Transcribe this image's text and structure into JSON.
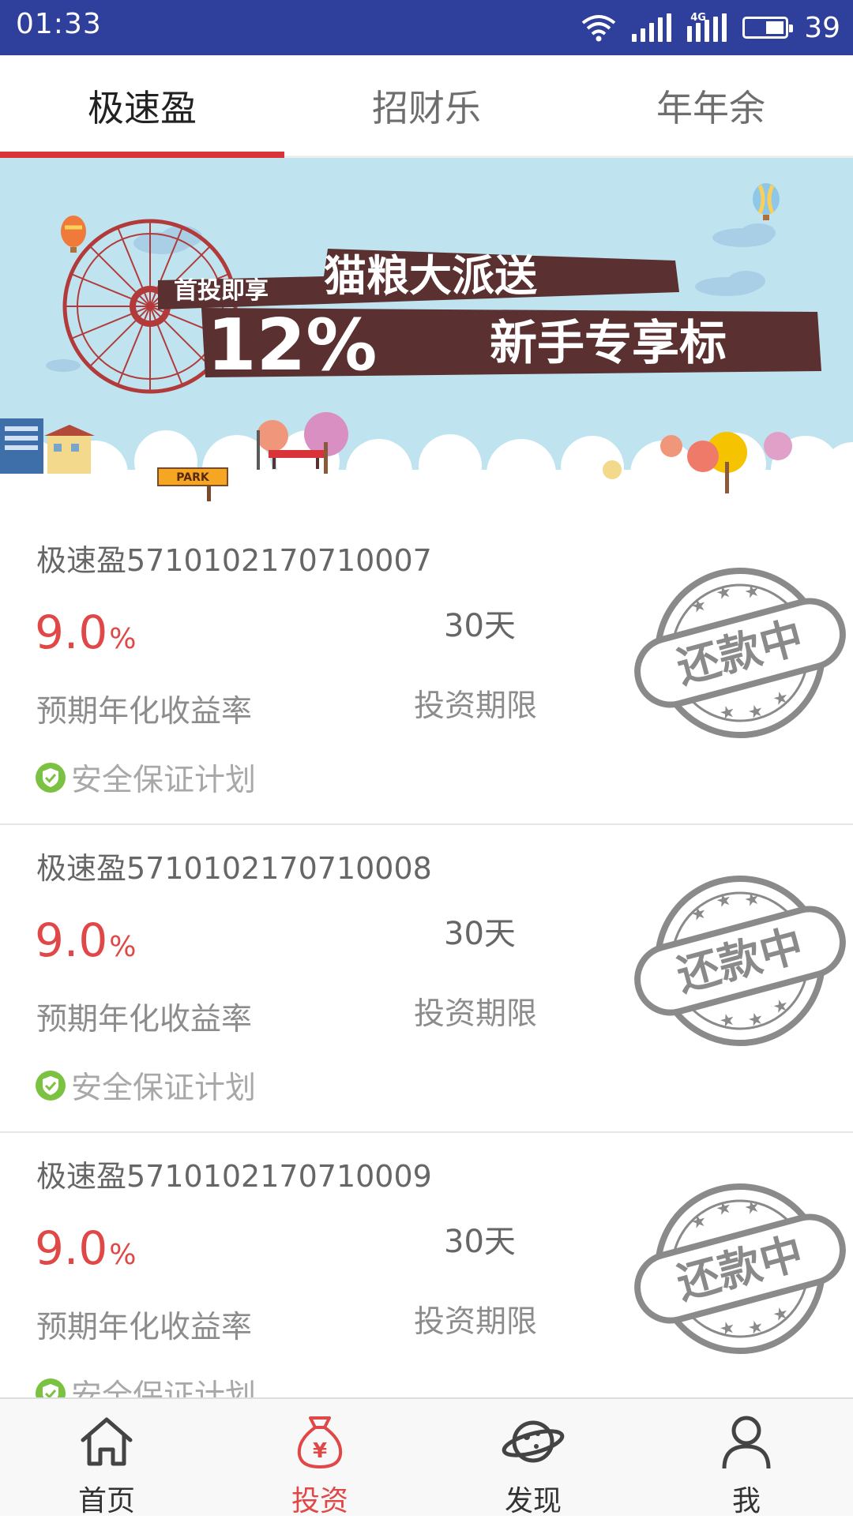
{
  "status_bar": {
    "time": "01:33",
    "network_tag": "4G",
    "battery": "39"
  },
  "tabs": [
    {
      "label": "极速盈",
      "active": true
    },
    {
      "label": "招财乐",
      "active": false
    },
    {
      "label": "年年余",
      "active": false
    }
  ],
  "banner": {
    "line1_small": "首投即享",
    "line1_big": "猫粮大派送",
    "line2_percent": "12%",
    "line2_text": "新手专享标",
    "park_sign": "PARK"
  },
  "products": [
    {
      "name": "极速盈5710102170710007",
      "rate": "9.0",
      "rate_unit": "%",
      "rate_label": "预期年化收益率",
      "term": "30天",
      "term_label": "投资期限",
      "safety": "安全保证计划",
      "status": "还款中"
    },
    {
      "name": "极速盈5710102170710008",
      "rate": "9.0",
      "rate_unit": "%",
      "rate_label": "预期年化收益率",
      "term": "30天",
      "term_label": "投资期限",
      "safety": "安全保证计划",
      "status": "还款中"
    },
    {
      "name": "极速盈5710102170710009",
      "rate": "9.0",
      "rate_unit": "%",
      "rate_label": "预期年化收益率",
      "term": "30天",
      "term_label": "投资期限",
      "safety": "安全保证计划",
      "status": "还款中"
    }
  ],
  "bottom_nav": [
    {
      "label": "首页",
      "icon": "home-icon",
      "active": false
    },
    {
      "label": "投资",
      "icon": "money-bag-icon",
      "active": true
    },
    {
      "label": "发现",
      "icon": "planet-icon",
      "active": false
    },
    {
      "label": "我",
      "icon": "user-icon",
      "active": false
    }
  ],
  "colors": {
    "status_bar": "#2f3f9c",
    "accent_red": "#e04848",
    "tab_indicator": "#d9333a",
    "safety_green": "#7cc242",
    "banner_sky": "#bfe4ef",
    "banner_plate": "#5a3030"
  }
}
